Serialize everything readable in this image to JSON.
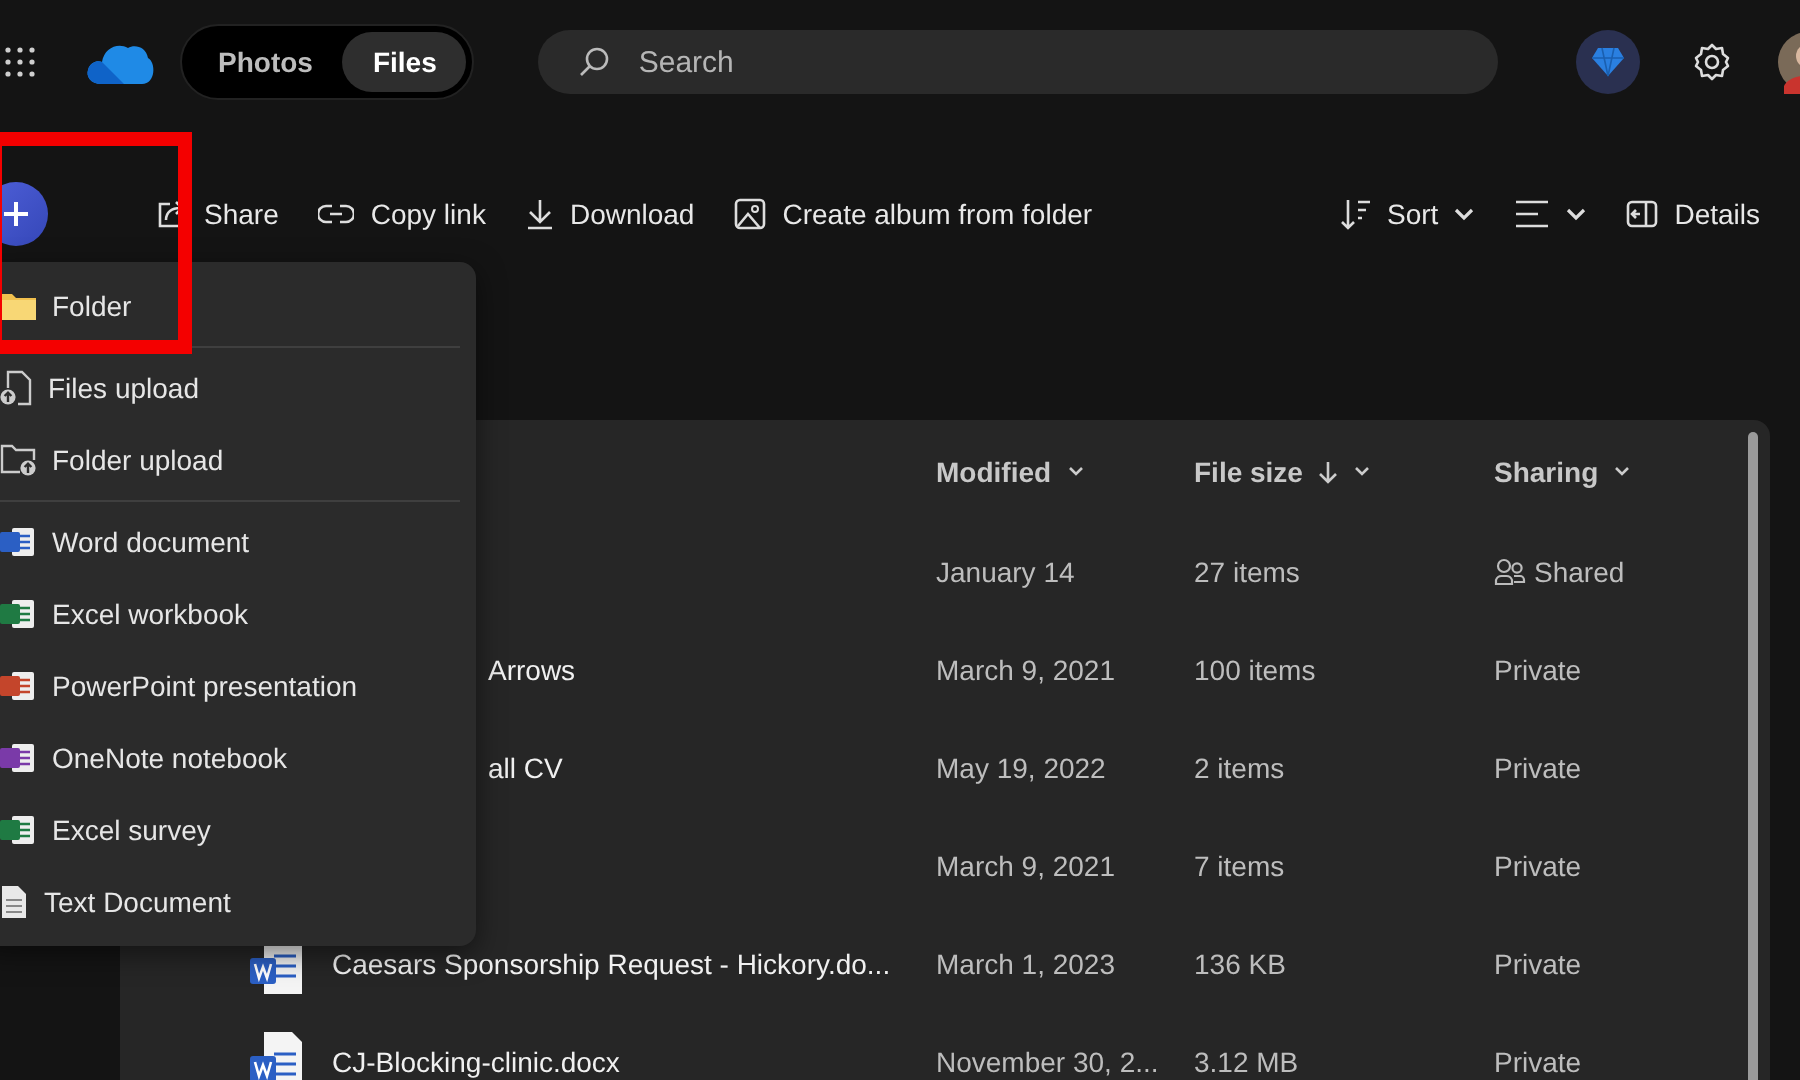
{
  "topbar": {
    "tabs": [
      {
        "label": "Photos",
        "selected": false
      },
      {
        "label": "Files",
        "selected": true
      }
    ],
    "search": {
      "placeholder": "Search"
    }
  },
  "toolbar": {
    "actions": [
      {
        "kind": "share",
        "label": "Share"
      },
      {
        "kind": "link",
        "label": "Copy link"
      },
      {
        "kind": "download",
        "label": "Download"
      },
      {
        "kind": "album",
        "label": "Create album from folder"
      }
    ],
    "right": [
      {
        "kind": "sort",
        "label": "Sort"
      },
      {
        "kind": "view"
      },
      {
        "kind": "details",
        "label": "Details"
      }
    ]
  },
  "new_menu": {
    "sections": [
      [
        {
          "kind": "folder",
          "label": "Folder"
        }
      ],
      [
        {
          "kind": "file-upload",
          "label": "Files upload"
        },
        {
          "kind": "folder-upload",
          "label": "Folder upload"
        }
      ],
      [
        {
          "kind": "word",
          "label": "Word document"
        },
        {
          "kind": "excel",
          "label": "Excel workbook"
        },
        {
          "kind": "powerpoint",
          "label": "PowerPoint presentation"
        },
        {
          "kind": "onenote",
          "label": "OneNote notebook"
        },
        {
          "kind": "excel",
          "label": "Excel survey"
        },
        {
          "kind": "text",
          "label": "Text Document"
        }
      ]
    ]
  },
  "table": {
    "columns": [
      {
        "label": "Modified",
        "sorted": false
      },
      {
        "label": "File size",
        "sorted": true
      },
      {
        "label": "Sharing",
        "sorted": false
      }
    ],
    "rows": [
      {
        "kind": "folder",
        "modified": "January 14",
        "size": "27 items",
        "sharing": "Shared",
        "shared": true
      },
      {
        "kind": "folder",
        "name": "Arrows",
        "modified": "March 9, 2021",
        "size": "100 items",
        "sharing": "Private",
        "shared": false
      },
      {
        "kind": "folder",
        "name": "all CV",
        "modified": "May 19, 2022",
        "size": "2 items",
        "sharing": "Private",
        "shared": false
      },
      {
        "kind": "folder",
        "modified": "March 9, 2021",
        "size": "7 items",
        "sharing": "Private",
        "shared": false
      },
      {
        "kind": "word",
        "name": "Caesars Sponsorship Request - Hickory.do...",
        "modified": "March 1, 2023",
        "size": "136 KB",
        "sharing": "Private",
        "shared": false
      },
      {
        "kind": "word",
        "name": "CJ-Blocking-clinic.docx",
        "modified": "November 30, 2...",
        "size": "3.12 MB",
        "sharing": "Private",
        "shared": false
      }
    ]
  }
}
